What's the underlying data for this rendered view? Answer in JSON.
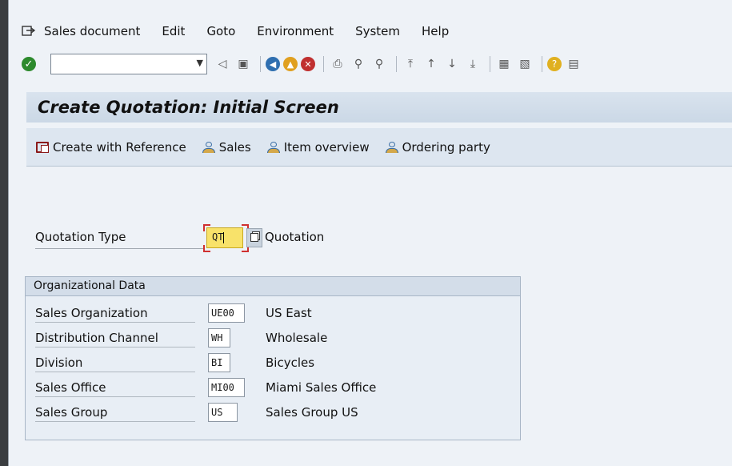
{
  "menu": {
    "items": [
      {
        "label": "Sales document"
      },
      {
        "label": "Edit"
      },
      {
        "label": "Goto"
      },
      {
        "label": "Environment"
      },
      {
        "label": "System"
      },
      {
        "label": "Help"
      }
    ]
  },
  "toolbar": {
    "command_value": ""
  },
  "title": "Create Quotation: Initial Screen",
  "app_toolbar": {
    "create_with_reference": "Create with Reference",
    "sales": "Sales",
    "item_overview": "Item overview",
    "ordering_party": "Ordering party"
  },
  "quotation_type": {
    "label": "Quotation Type",
    "value": "QT",
    "description": "Quotation"
  },
  "org_data": {
    "title": "Organizational Data",
    "rows": [
      {
        "label": "Sales Organization",
        "value": "UE00",
        "description": "US East"
      },
      {
        "label": "Distribution Channel",
        "value": "WH",
        "description": "Wholesale"
      },
      {
        "label": "Division",
        "value": "BI",
        "description": "Bicycles"
      },
      {
        "label": "Sales Office",
        "value": "MI00",
        "description": "Miami Sales Office"
      },
      {
        "label": "Sales Group",
        "value": "US",
        "description": "Sales Group US"
      }
    ]
  },
  "colors": {
    "title_bar": "#cbd8e6",
    "required_field": "#f8e26a"
  }
}
